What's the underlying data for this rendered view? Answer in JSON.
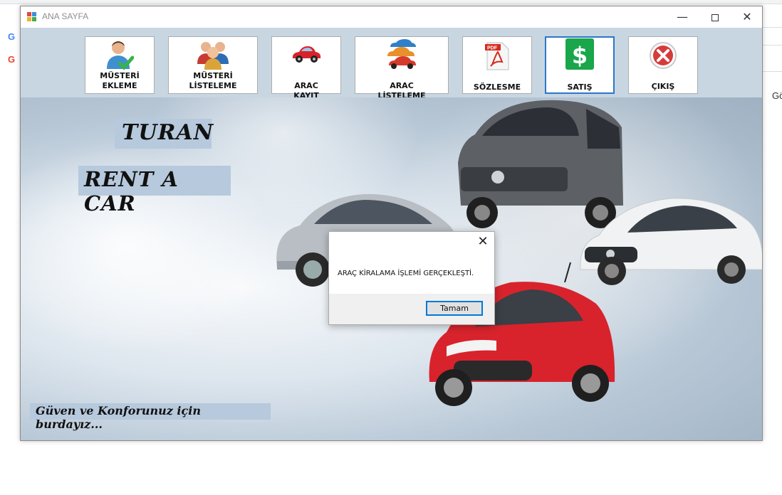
{
  "window": {
    "title": "ANA SAYFA",
    "minimize_glyph": "—",
    "close_glyph": "✕"
  },
  "toolbar": {
    "buttons": [
      {
        "label": "MÜSTERİ EKLEME",
        "icon": "user-add-icon"
      },
      {
        "label": "MÜSTERİ LİSTELEME",
        "icon": "users-group-icon"
      },
      {
        "label": "ARAC KAYIT",
        "icon": "red-car-icon"
      },
      {
        "label": "ARAC LİSTELEME",
        "icon": "cars-stack-icon"
      },
      {
        "label": "SÖZLESME",
        "icon": "pdf-file-icon"
      },
      {
        "label": "SATIŞ",
        "icon": "dollar-icon"
      },
      {
        "label": "ÇIKIŞ",
        "icon": "exit-x-icon"
      }
    ],
    "active_button": "SATIŞ"
  },
  "hero": {
    "brand_line1": "TURAN",
    "brand_line2": "RENT A CAR",
    "slogan": "Güven ve Konforunuz  için burdayız..."
  },
  "dialog": {
    "message": "ARAÇ KİRALAMA İŞLEMİ GERÇEKLEŞTİ.",
    "ok_label": "Tamam",
    "close_glyph": "✕"
  },
  "background_app": {
    "icon_letter": "G",
    "cut_text": "Gö"
  },
  "colors": {
    "accent_border": "#2a77c9",
    "dollar_green": "#1aa64a",
    "exit_red": "#d63b3b",
    "label_bg": "#b7c9dc",
    "toolbar_bg": "#c8d6e2"
  }
}
